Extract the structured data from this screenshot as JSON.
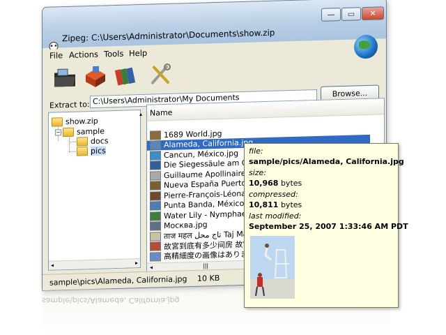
{
  "window": {
    "title": "Zipeg: C:\\Users\\Administrator\\Documents\\show.zip",
    "controls": {
      "minimize": "—",
      "maximize": "▭",
      "close": "✕"
    }
  },
  "menu": [
    "File",
    "Actions",
    "Tools",
    "Help"
  ],
  "toolbar": {
    "buttons": [
      {
        "name": "open-archive",
        "icon": "folder-archive-icon"
      },
      {
        "name": "extract",
        "icon": "box-extract-icon"
      },
      {
        "name": "extract-all",
        "icon": "books-icon"
      },
      {
        "name": "options",
        "icon": "tools-icon"
      }
    ]
  },
  "extract": {
    "label": "Extract to:",
    "path": "C:\\Users\\Administrator\\My Documents",
    "browse_label": "Browse..."
  },
  "tree": {
    "items": [
      {
        "label": "show.zip",
        "level": 0
      },
      {
        "label": "sample",
        "level": 1
      },
      {
        "label": "docs",
        "level": 2
      },
      {
        "label": "pics",
        "level": 2,
        "selected": true
      }
    ]
  },
  "files": {
    "column_name": "Name",
    "rows": [
      {
        "name": "1689 World.jpg",
        "color": "#8a6d3b"
      },
      {
        "name": "Alameda, California.jpg",
        "color": "#5b87b8",
        "selected": true
      },
      {
        "name": "Cancun, México.jpg",
        "color": "#3a8ec9"
      },
      {
        "name": "Die Siegessäule am Großer Stern",
        "color": "#2c5f9e"
      },
      {
        "name": "Guillaume Apollinaire, Hôtel",
        "color": "#a9a9a9"
      },
      {
        "name": "Nueva España Puerto de",
        "color": "#7a5e2e"
      },
      {
        "name": "Pierre-François-Léonard",
        "color": "#6b4a2b"
      },
      {
        "name": "Punta Banda, México.jpg",
        "color": "#4a7fb5"
      },
      {
        "name": "Water Lily - Nymphaeaceae",
        "color": "#3e7d3e"
      },
      {
        "name": "Москва.jpg",
        "color": "#5e6f8a"
      },
      {
        "name": "ताज महल تاج محل Taj Mahal",
        "color": "#c9c1a8"
      },
      {
        "name": "故宮到底有多少间房 故宫",
        "color": "#b84a3a"
      },
      {
        "name": "高精細度の画像はありま",
        "color": "#6a8cc9"
      }
    ]
  },
  "status": {
    "path": "sample\\pics\\Alameda, California.jpg",
    "size": "10 KB"
  },
  "tooltip": {
    "file_label": "file:",
    "file_value": "sample/pics/Alameda, California.jpg",
    "size_label": "size:",
    "size_value": "10,968",
    "size_unit": "bytes",
    "compressed_label": "compressed:",
    "compressed_value": "10,811",
    "compressed_unit": "bytes",
    "modified_label": "last modified:",
    "modified_value": "September 25, 2007 1:33:46 AM PDT"
  },
  "colors": {
    "selection": "#316ac5",
    "tooltip_bg": "#ffffe1",
    "window_bg": "#ece9d8"
  }
}
